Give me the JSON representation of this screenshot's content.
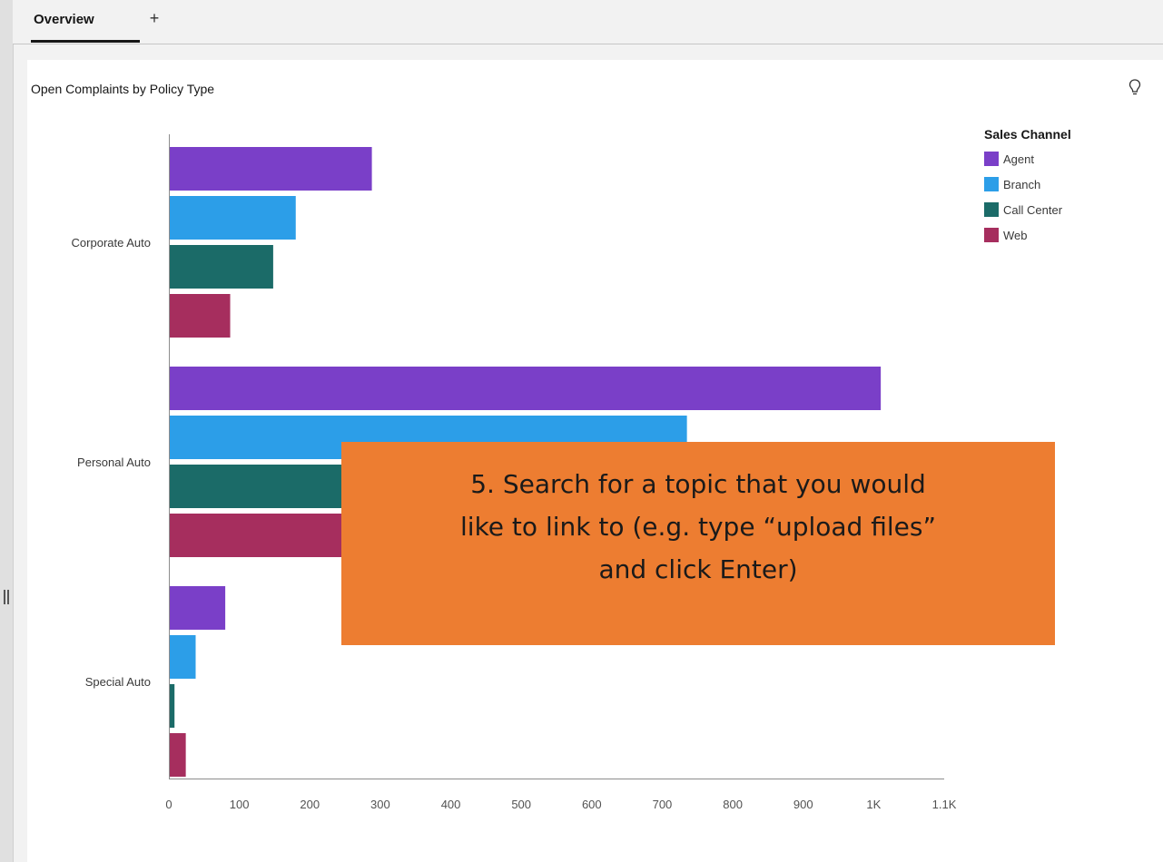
{
  "tabs": [
    {
      "label": "Overview",
      "active": true
    }
  ],
  "add_tab_label": "+",
  "card": {
    "title": "Open Complaints by Policy Type",
    "insight_icon": "lightbulb-icon"
  },
  "chart_data": {
    "type": "bar",
    "orientation": "horizontal",
    "title": "Open Complaints by Policy Type",
    "categories": [
      "Corporate Auto",
      "Personal Auto",
      "Special Auto"
    ],
    "series": [
      {
        "name": "Agent",
        "color": "#7a3fc8",
        "values": [
          288,
          1010,
          80
        ]
      },
      {
        "name": "Branch",
        "color": "#2c9ee8",
        "values": [
          180,
          735,
          38
        ]
      },
      {
        "name": "Call Center",
        "color": "#1b6b68",
        "values": [
          148,
          510,
          8
        ]
      },
      {
        "name": "Web",
        "color": "#a62e5e",
        "values": [
          87,
          470,
          24
        ]
      }
    ],
    "xlim": [
      0,
      1100
    ],
    "xticks": [
      "0",
      "100",
      "200",
      "300",
      "400",
      "500",
      "600",
      "700",
      "800",
      "900",
      "1K",
      "1.1K"
    ],
    "legend": {
      "title": "Sales Channel",
      "position": "top-right"
    },
    "grid": false
  },
  "annotation": {
    "lines": [
      "5. Search for a topic that you would",
      "like to link to (e.g. type “upload files”",
      "and click Enter)"
    ],
    "background": "#ed7d31"
  }
}
